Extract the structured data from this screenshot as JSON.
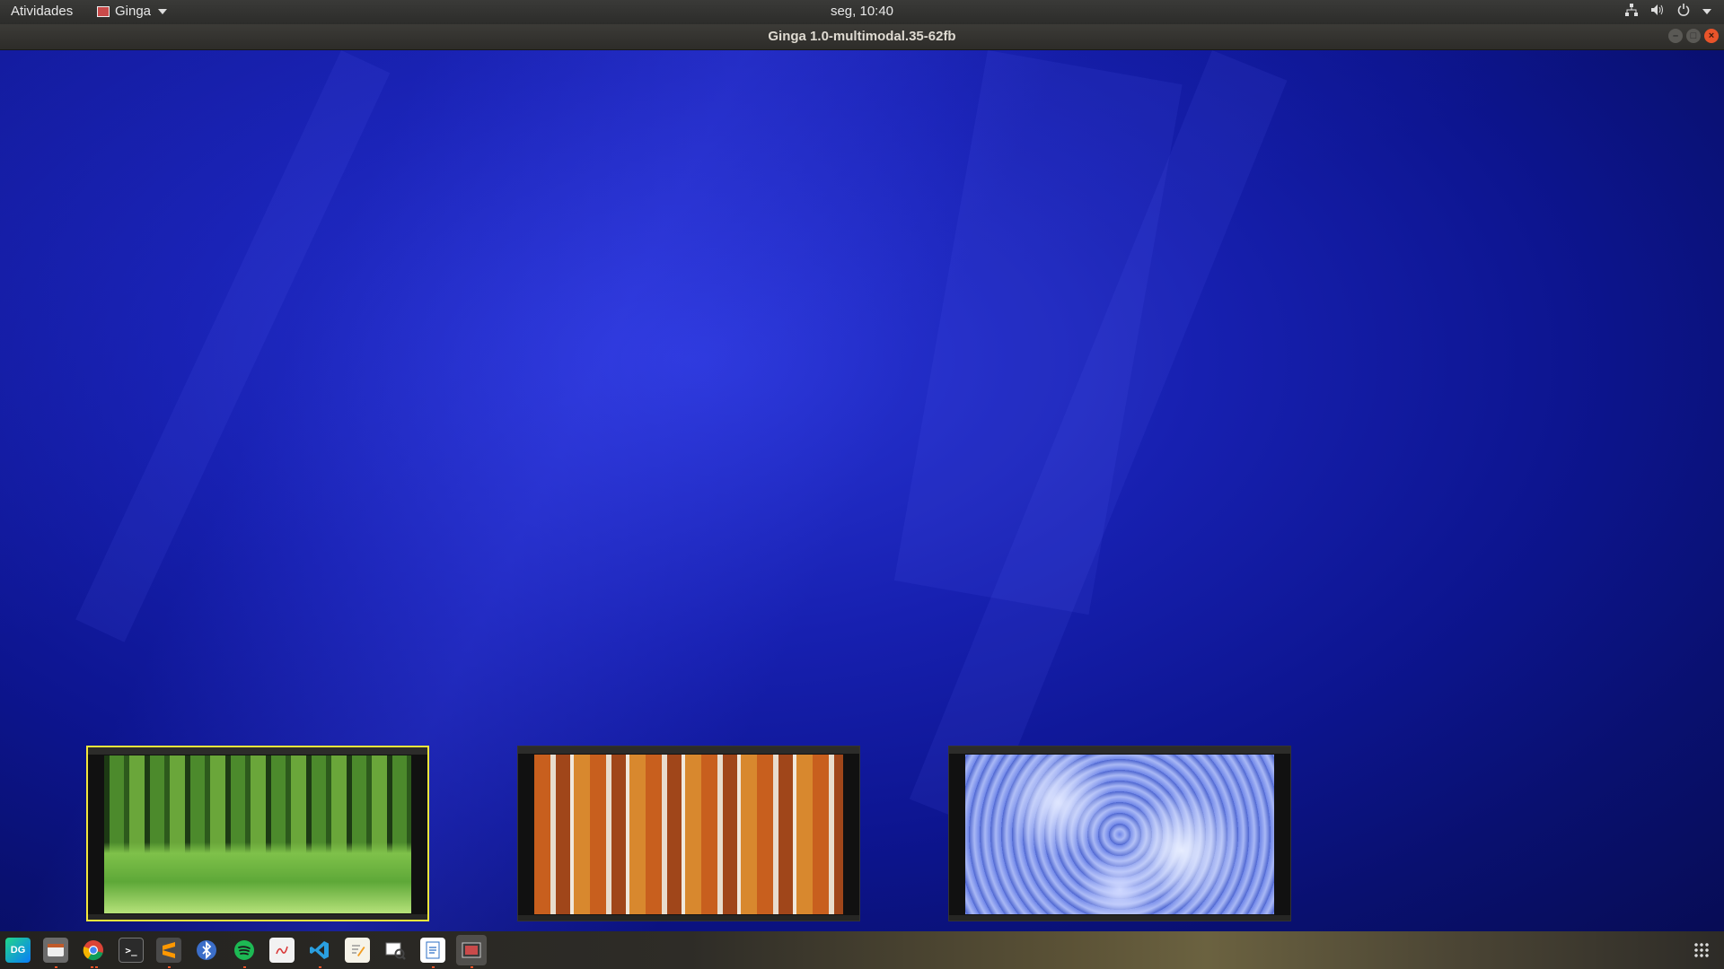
{
  "topbar": {
    "activities_label": "Atividades",
    "app_menu_label": "Ginga",
    "clock": "seg, 10:40",
    "tray_icons": [
      "network-icon",
      "volume-icon",
      "power-icon",
      "chevron-down-icon"
    ]
  },
  "window": {
    "title": "Ginga 1.0-multimodal.35-62fb",
    "controls": [
      "minimize-icon",
      "maximize-icon",
      "close-icon"
    ]
  },
  "thumbnails": [
    {
      "scene": "green-forest-meadow",
      "selected": true
    },
    {
      "scene": "autumn-birch-forest",
      "selected": false
    },
    {
      "scene": "snowy-trees-aerial",
      "selected": false
    }
  ],
  "dock": {
    "items": [
      {
        "name": "datagrip-icon",
        "label": "DG"
      },
      {
        "name": "files-icon",
        "label": ""
      },
      {
        "name": "chrome-icon",
        "label": ""
      },
      {
        "name": "terminal-icon",
        "label": ">_"
      },
      {
        "name": "sublime-text-icon",
        "label": ""
      },
      {
        "name": "bluetooth-icon",
        "label": ""
      },
      {
        "name": "spotify-icon",
        "label": ""
      },
      {
        "name": "text-editor-icon",
        "label": ""
      },
      {
        "name": "vscode-icon",
        "label": ""
      },
      {
        "name": "notes-icon",
        "label": ""
      },
      {
        "name": "image-viewer-icon",
        "label": ""
      },
      {
        "name": "document-icon",
        "label": ""
      },
      {
        "name": "ginga-app-icon",
        "label": ""
      }
    ],
    "show_apps_icon": "grid-icon"
  }
}
